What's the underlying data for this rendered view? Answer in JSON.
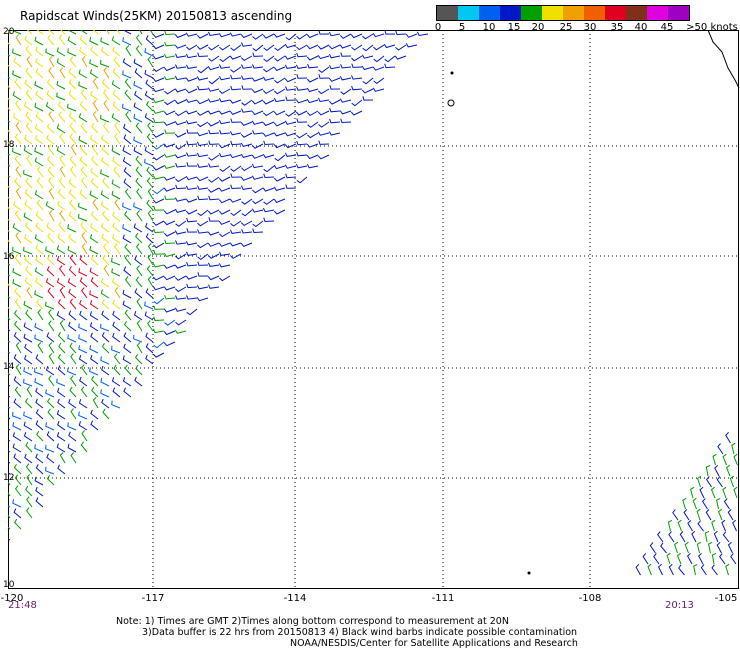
{
  "title": "Rapidscat Winds(25KM) 20150813 ascending",
  "legend": {
    "colors": [
      "#555555",
      "#8a8a8a",
      "#00b8e8",
      "#00d8f0",
      "#0070f0",
      "#0020d0",
      "#20a020",
      "#00d000",
      "#f0e000",
      "#f0b000",
      "#f08000",
      "#f04000",
      "#e00020",
      "#903010",
      "#c08060",
      "#e000e0",
      "#c000c0",
      "#800080",
      "#3a0070"
    ],
    "labels": [
      "0",
      "5",
      "10",
      "15",
      "20",
      "25",
      "30",
      "35",
      "40",
      "45",
      ">50 knots"
    ]
  },
  "y_ticks": [
    "20",
    "18",
    "16",
    "14",
    "12",
    "10"
  ],
  "x_ticks": [
    "-120",
    "-117",
    "-114",
    "-111",
    "-108",
    "-105"
  ],
  "times": {
    "left": "21:48",
    "right": "20:13"
  },
  "notes": {
    "line1": "Note: 1) Times are GMT 2)Times along bottom correspond to measurement at 20N",
    "line2": "3)Data buffer is 22 hrs from 20150813 4) Black wind barbs indicate possible contamination",
    "credit": "NOAA/NESDIS/Center for Satellite Applications and Research"
  }
}
